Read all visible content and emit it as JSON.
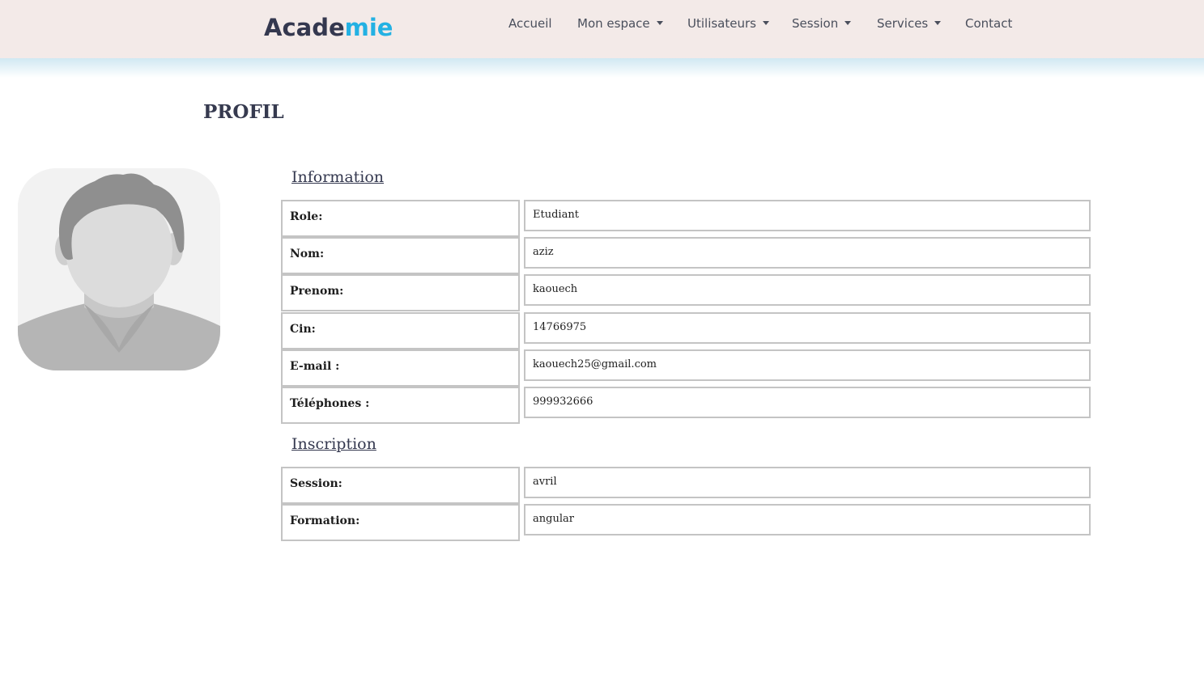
{
  "navbar": {
    "brand_part1": "Acade",
    "brand_part2": "mie",
    "items": [
      {
        "label": "Accueil",
        "has_dropdown": false
      },
      {
        "label": "Mon espace",
        "has_dropdown": true
      },
      {
        "label": "Utilisateurs",
        "has_dropdown": true
      },
      {
        "label": "Session",
        "has_dropdown": true
      },
      {
        "label": "Services",
        "has_dropdown": true
      },
      {
        "label": "Contact",
        "has_dropdown": false
      }
    ]
  },
  "page": {
    "title": "PROFIL"
  },
  "avatar": {
    "icon": "default-user-avatar"
  },
  "information": {
    "heading": "Information",
    "rows": [
      {
        "label": "Role:",
        "value": "Etudiant"
      },
      {
        "label": "Nom:",
        "value": "aziz"
      },
      {
        "label": "Prenom:",
        "value": "kaouech"
      },
      {
        "label": "Cin:",
        "value": "14766975"
      },
      {
        "label": "E-mail :",
        "value": "kaouech25@gmail.com"
      },
      {
        "label": "Téléphones :",
        "value": "999932666"
      }
    ]
  },
  "inscription": {
    "heading": "Inscription",
    "rows": [
      {
        "label": "Session:",
        "value": "avril"
      },
      {
        "label": "Formation:",
        "value": "angular"
      }
    ]
  },
  "colors": {
    "navbar_bg": "#f3eae8",
    "brand_dark": "#34384f",
    "brand_accent": "#23b1e3",
    "nav_text": "#4a4f5c",
    "cell_border": "#c4c4c4"
  }
}
